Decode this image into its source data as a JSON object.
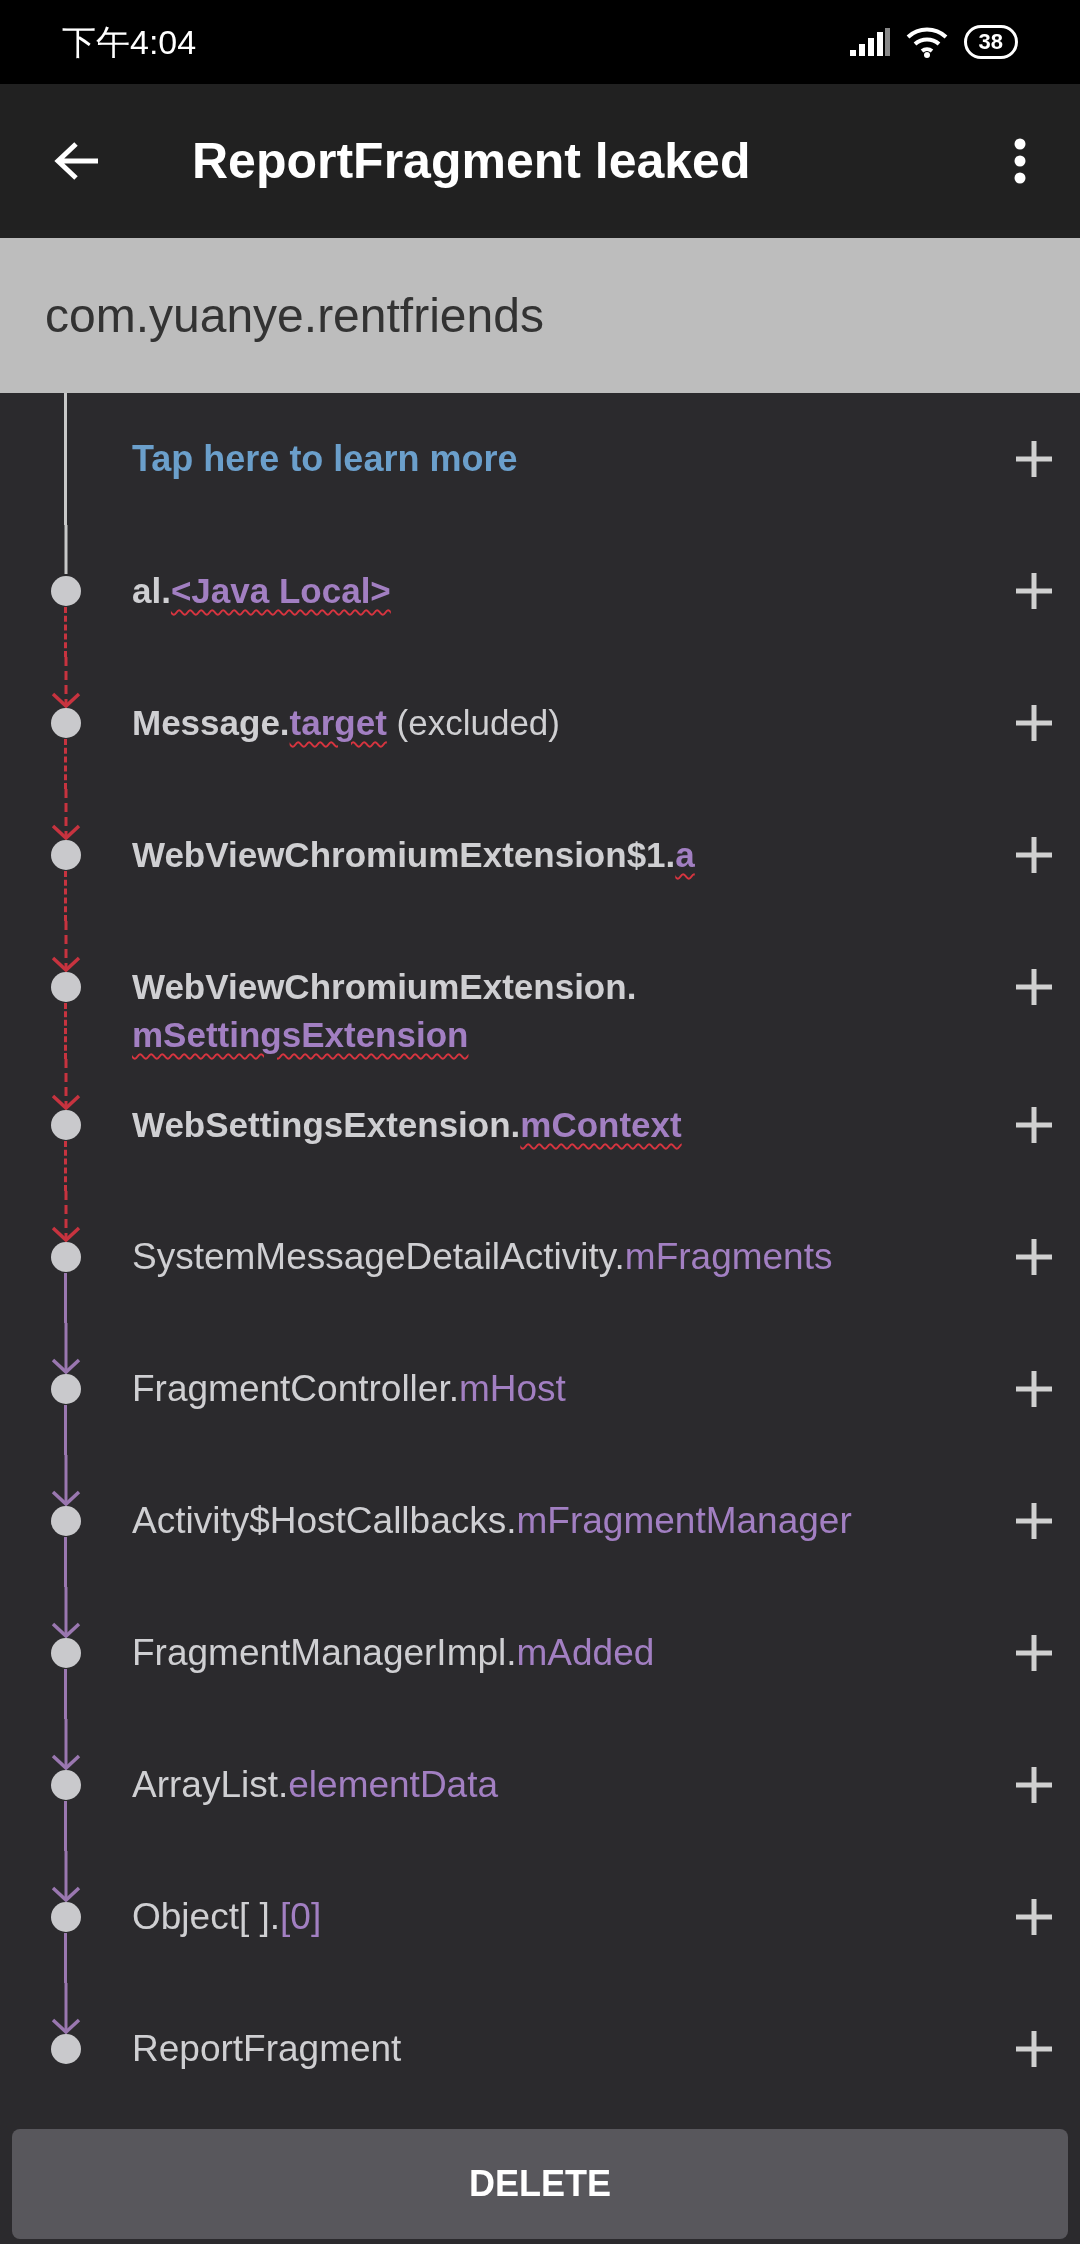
{
  "status_bar": {
    "time": "下午4:04",
    "battery": "38"
  },
  "toolbar": {
    "title": "ReportFragment leaked"
  },
  "package": "com.yuanye.rentfriends",
  "rows": [
    {
      "kind": "help",
      "text": "Tap here to learn more"
    },
    {
      "kind": "root",
      "suspect": true,
      "class_name": "al.",
      "field": "<Java Local>"
    },
    {
      "kind": "leak",
      "suspect": true,
      "class_name": "Message.",
      "field": "target",
      "suffix": "(excluded)"
    },
    {
      "kind": "leak",
      "suspect": true,
      "class_name": "WebViewChromiumExtension$1.",
      "field": "a"
    },
    {
      "kind": "leak",
      "suspect": true,
      "class_name": "WebViewChromiumExtension.",
      "field": "mSettingsExtension"
    },
    {
      "kind": "leak",
      "suspect": true,
      "class_name": "WebSettingsExtension.",
      "field": "mContext"
    },
    {
      "kind": "leak",
      "suspect": false,
      "class_name": "SystemMessageDetailActivity.",
      "field": "mFragments"
    },
    {
      "kind": "reference",
      "suspect": false,
      "class_name": "FragmentController.",
      "field": "mHost"
    },
    {
      "kind": "reference",
      "suspect": false,
      "class_name": "Activity$HostCallbacks.",
      "field": "mFragmentManager"
    },
    {
      "kind": "reference",
      "suspect": false,
      "class_name": "FragmentManagerImpl.",
      "field": "mAdded"
    },
    {
      "kind": "reference",
      "suspect": false,
      "class_name": "ArrayList.",
      "field": "elementData"
    },
    {
      "kind": "reference",
      "suspect": false,
      "class_name": "Object[ ].",
      "field": "[0]"
    },
    {
      "kind": "reference",
      "suspect": false,
      "class_name": "ReportFragment"
    }
  ],
  "delete_button": "DELETE"
}
